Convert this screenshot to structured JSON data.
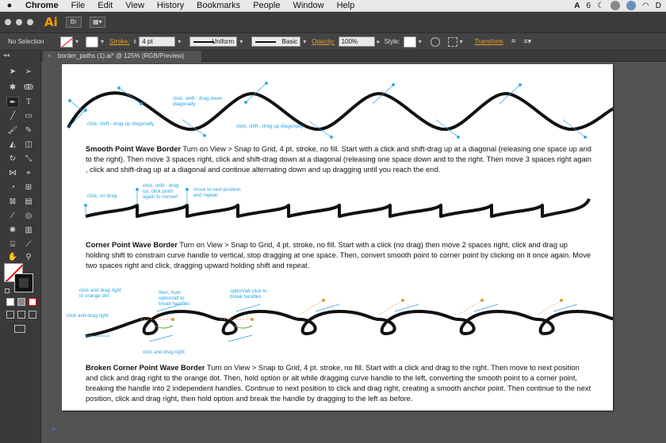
{
  "menubar": {
    "apple": "",
    "items": [
      "Chrome",
      "File",
      "Edit",
      "View",
      "History",
      "Bookmarks",
      "People",
      "Window",
      "Help"
    ],
    "tray": {
      "adobe_count": "6"
    }
  },
  "app": {
    "logo": "Ai"
  },
  "control": {
    "selection": "No Selection",
    "stroke_label": "Stroke:",
    "stroke_value": "4 pt",
    "profile": "Uniform",
    "brush": "Basic",
    "opacity_label": "Opacity:",
    "opacity_value": "100%",
    "style_label": "Style:",
    "transform_label": "Transform"
  },
  "document": {
    "tab_title": "border_paths (1).ai* @ 125% (RGB/Preview)",
    "close": "×"
  },
  "tools_header": "◂◂",
  "colors": {
    "accent": "#27a3e0",
    "orange": "#e8962c",
    "green": "#5aaa3a",
    "ai_orange": "#ff9a00"
  },
  "sections": [
    {
      "title": "Smooth Point Wave Border",
      "body": " Turn on View > Snap to Grid, 4 pt. stroke, no fill. Start with a click and shift-drag up at a diagonal (releasing one space up and to the right). Then move 3 spaces right, click and shift-drag down at a diagonal (releasing one space down and to the right. Then move 3 spaces right again , click and shift-drag up at a diagonal and continue alternating down and up dragging until you reach the end."
    },
    {
      "title": "Corner Point Wave Border",
      "body": " Turn on View > Snap to Grid, 4 pt. stroke, no fill. Start with a click (no drag) then move 2 spaces right, click and drag up holding shift to constrain curve handle to vertical, stop dragging at one space. Then, convert smooth point to corner point by clicking on it once again. Move two spaces right and click, dragging upward holding shift and repeat."
    },
    {
      "title": "Broken Corner Point Wave Border",
      "body": " Turn on View > Snap to Grid, 4 pt. stroke, no fill. Start with a click and drag to the right. Then move to next position and click and drag right to the orange dot. Then, hold option or alt while dragging curve handle to the left, converting the smooth point to a corner point, breaking the handle into 2 independent handles. Continue to next position to click and drag right, creating a smooth anchor point. Then continue to the next position, click and drag right, then hold option and break the handle by dragging to the left as before."
    }
  ],
  "annotations": {
    "wave1": {
      "a": "click, shift - drag down\ndiagonally",
      "b": "click, shift - drag up diagonally",
      "c": "click, shift - drag up diagonally"
    },
    "wave2": {
      "a": "click, no drag",
      "b": "click, shift - drag\nup, click point\nagain to convert",
      "c": "move to next position\nand repeat"
    },
    "wave3": {
      "a": "click and drag right\nto orange dot",
      "b": "then, hold\noption/alt to\nbreak handles",
      "c": "option/alt click to\nbreak handles",
      "d": "click and drag right",
      "e": "click and drag right"
    }
  }
}
